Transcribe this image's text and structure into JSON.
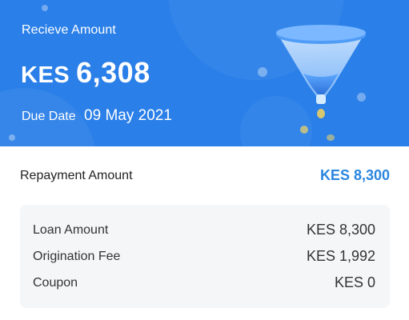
{
  "header": {
    "receive_label": "Recieve Amount",
    "currency": "KES",
    "receive_value": "6,308",
    "due_label": "Due Date",
    "due_date": "09 May 2021",
    "accent_color": "#2a7fe8",
    "illustration": "funnel-coins-icon"
  },
  "repayment": {
    "label": "Repayment Amount",
    "value": "KES 8,300",
    "value_color": "#2a86df"
  },
  "details": [
    {
      "label": "Loan Amount",
      "value": "KES 8,300"
    },
    {
      "label": "Origination Fee",
      "value": "KES 1,992"
    },
    {
      "label": "Coupon",
      "value": "KES 0"
    }
  ]
}
